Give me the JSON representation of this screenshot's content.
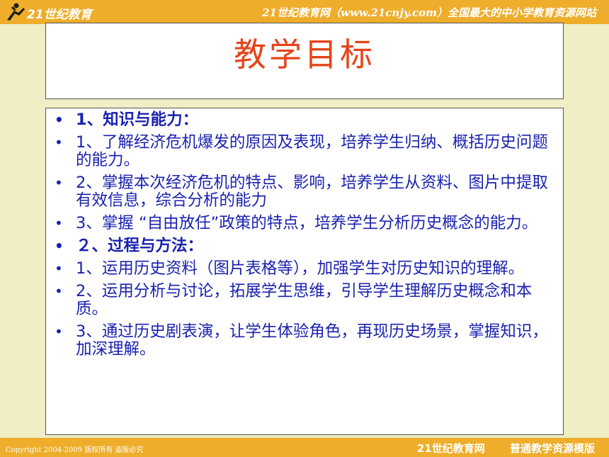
{
  "header": {
    "logo_text": "21世纪教育",
    "slogan": "21世纪教育网（www.21cnjy.com）全国最大的中小学教育资源网站"
  },
  "slide": {
    "title": "教学目标",
    "items": [
      {
        "text": "1、知识与能力：",
        "head": true
      },
      {
        "text": "1、了解经济危机爆发的原因及表现，培养学生归纳、概括历史问题的能力。",
        "head": false
      },
      {
        "text": "2、掌握本次经济危机的特点、影响，培养学生从资料、图片中提取有效信息，综合分析的能力",
        "head": false
      },
      {
        "text": "3、掌握 “自由放任”政策的特点，培养学生分析历史概念的能力。",
        "head": false
      },
      {
        "text": "２、过程与方法：",
        "head": true
      },
      {
        "text": "1、运用历史资料（图片表格等），加强学生对历史知识的理解。",
        "head": false
      },
      {
        "text": "2、运用分析与讨论，拓展学生思维，引导学生理解历史概念和本质。",
        "head": false
      },
      {
        "text": "3、通过历史剧表演，让学生体验角色，再现历史场景，掌握知识，加深理解。",
        "head": false
      }
    ]
  },
  "footer": {
    "copyright": "Copyright 2004-2009 版权所有 盗版必究",
    "site": "21世纪教育网",
    "template": "普通教学资源模版"
  },
  "colors": {
    "bar": "#eead2a",
    "title": "#e5441a",
    "body_text": "#1a22b0",
    "background": "#efeec4"
  }
}
